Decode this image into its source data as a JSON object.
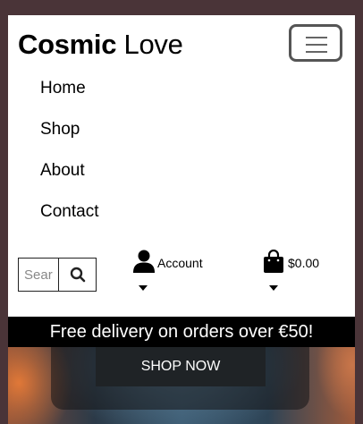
{
  "brand": {
    "bold": "Cosmic",
    "regular": "Love"
  },
  "menu_toggle": {
    "icon": "hamburger-icon"
  },
  "nav": {
    "items": [
      {
        "label": "Home"
      },
      {
        "label": "Shop"
      },
      {
        "label": "About"
      },
      {
        "label": "Contact"
      }
    ]
  },
  "search": {
    "placeholder": "Search",
    "icon": "search-icon"
  },
  "account": {
    "label": "Account",
    "icon": "user-icon"
  },
  "bag": {
    "total": "$0.00",
    "icon": "shopping-bag-icon"
  },
  "banner": {
    "text": "Free delivery on orders over €50!"
  },
  "hero": {
    "button_label": "SHOP NOW"
  }
}
